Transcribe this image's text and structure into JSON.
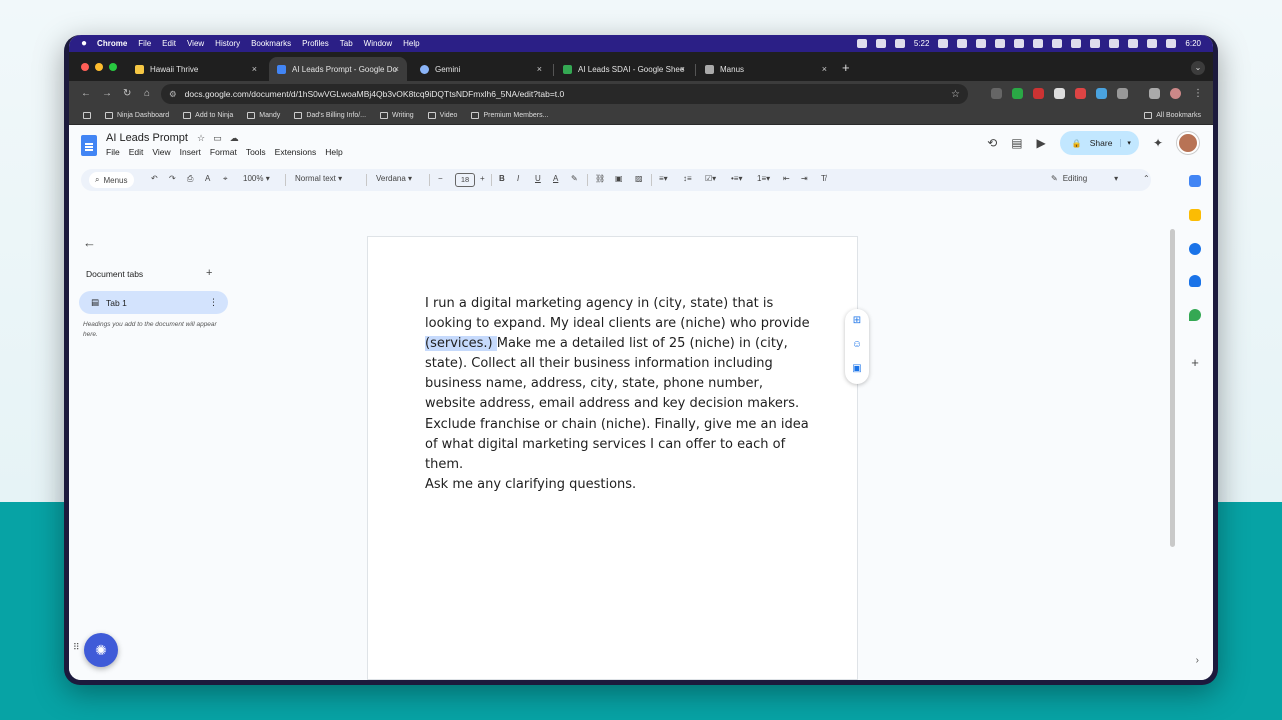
{
  "menubar": {
    "apple": "",
    "items": [
      "Chrome",
      "File",
      "Edit",
      "View",
      "History",
      "Bookmarks",
      "Profiles",
      "Tab",
      "Window",
      "Help"
    ],
    "timer": "5:22",
    "clock": "6:20"
  },
  "tabs": [
    {
      "label": "Hawaii Thrive",
      "color": "#f6c744"
    },
    {
      "label": "AI Leads Prompt - Google Do",
      "color": "#4285f4"
    },
    {
      "label": "Gemini",
      "color": "#8ab4f8"
    },
    {
      "label": "AI Leads SDAI - Google Shee",
      "color": "#34a853"
    },
    {
      "label": "Manus",
      "color": "#aaaaaa"
    }
  ],
  "tab_close": "×",
  "new_tab": "+",
  "address": {
    "url": "docs.google.com/document/d/1hS0wVGLwoaMBj4Qb3vOK8tcq9iDQTtsNDFmxlh6_5NA/edit?tab=t.0"
  },
  "bookmarks": [
    {
      "label": "Ninja Dashboard"
    },
    {
      "label": "Add to Ninja"
    },
    {
      "label": "Mandy"
    },
    {
      "label": "Dad's Billing Info/..."
    },
    {
      "label": "Writing"
    },
    {
      "label": "Video"
    },
    {
      "label": "Premium Members..."
    }
  ],
  "all_bookmarks": "All Bookmarks",
  "doc": {
    "title": "AI Leads Prompt",
    "menu": [
      "File",
      "Edit",
      "View",
      "Insert",
      "Format",
      "Tools",
      "Extensions",
      "Help"
    ],
    "share": "Share"
  },
  "toolbar": {
    "menus": "Menus",
    "zoom": "100%",
    "style": "Normal text",
    "font": "Verdana",
    "font_size": "18",
    "mode": "Editing"
  },
  "sidebar": {
    "heading": "Document tabs",
    "tab_label": "Tab 1",
    "hint": "Headings you add to the document will appear here."
  },
  "content": {
    "before": "I run a digital marketing agency in (city, state) that is looking to expand. My ideal clients are (niche) who provide",
    "highlight": " (services.) ",
    "after": "Make me a detailed list of 25 (niche) in (city, state). Collect all their business information including business name, address, city, state, phone number, website address, email address and key decision makers.  Exclude franchise or chain (niche). Finally, give me an idea of what digital marketing services I can offer to each of them.",
    "last_line": "Ask me any clarifying questions."
  }
}
